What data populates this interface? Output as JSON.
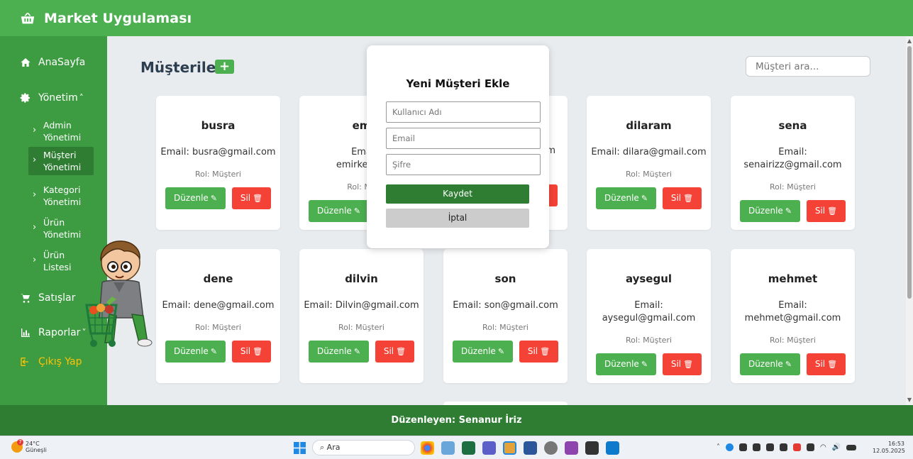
{
  "app": {
    "title": "Market Uygulaması",
    "icon": "basket-icon"
  },
  "sidebar": {
    "home": "AnaSayfa",
    "management": "Yönetim",
    "sub": [
      {
        "line1": "Admin",
        "line2": "Yönetimi"
      },
      {
        "line1": "Müşteri",
        "line2": "Yönetimi"
      },
      {
        "line1": "Kategori",
        "line2": "Yönetimi"
      },
      {
        "line1": "Ürün",
        "line2": "Yönetimi"
      },
      {
        "line1": "Ürün",
        "line2": "Listesi"
      }
    ],
    "sales": "Satışlar",
    "reports": "Raporlar",
    "logout": "Çıkış Yap"
  },
  "main": {
    "title": "Müşteriler",
    "add_label": "+",
    "search_placeholder": "Müşteri ara...",
    "edit_label": "Düzenle",
    "delete_label": "Sil"
  },
  "customers": [
    {
      "name": "busra",
      "email": "Email: busra@gmail.com",
      "role": "Rol: Müşteri"
    },
    {
      "name": "em",
      "email1": "Ema",
      "email2": "emirke@gr",
      "role": "Rol: Mü"
    },
    {
      "email_tail": "m"
    },
    {
      "name": "dilaram",
      "email": "Email: dilara@gmail.com",
      "role": "Rol: Müşteri"
    },
    {
      "name": "sena",
      "email1": "Email:",
      "email2": "senairizz@gmail.com",
      "role": "Rol: Müşteri"
    },
    {
      "name": "dene",
      "email": "Email: dene@gmail.com",
      "role": "Rol: Müşteri"
    },
    {
      "name": "dilvin",
      "email": "Email: Dilvin@gmail.com",
      "role": "Rol: Müşteri"
    },
    {
      "name": "son",
      "email": "Email: son@gmail.com",
      "role": "Rol: Müşteri"
    },
    {
      "name": "aysegul",
      "email1": "Email:",
      "email2": "aysegul@gmail.com",
      "role": "Rol: Müşteri"
    },
    {
      "name": "mehmet",
      "email1": "Email:",
      "email2": "mehmet@gmail.com",
      "role": "Rol: Müşteri"
    }
  ],
  "modal": {
    "title": "Yeni Müşteri Ekle",
    "username_placeholder": "Kullanıcı Adı",
    "email_placeholder": "Email",
    "password_placeholder": "Şifre",
    "save": "Kaydet",
    "cancel": "İptal"
  },
  "footer": {
    "text": "Düzenleyen: Senanur İriz"
  },
  "taskbar": {
    "temp": "24°C",
    "weather": "Güneşli",
    "badge": "7",
    "search": "Ara",
    "time": "16:53",
    "date": "12.05.2025"
  },
  "colors": {
    "primary": "#4caf50",
    "sidebar": "#3d9c42",
    "footer": "#2e7d32",
    "danger": "#f44336",
    "warning": "#ffc107"
  }
}
